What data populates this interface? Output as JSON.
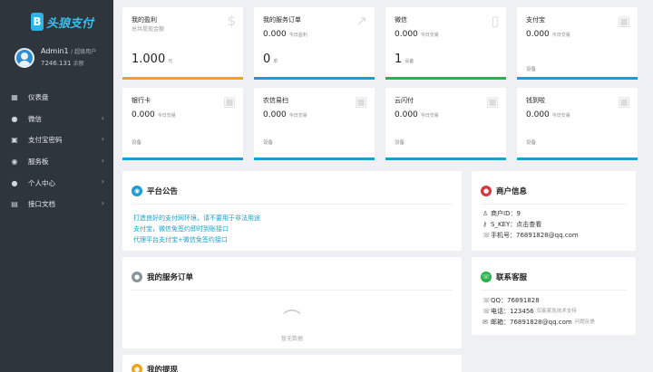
{
  "sidebar": {
    "logo_mark": "B",
    "logo_text": "头狼支付",
    "user_name": "Admin1",
    "user_role": "/ 超级用户",
    "balance": "7246.131",
    "balance_unit": "余额",
    "items": [
      {
        "label": "仪表盘",
        "icon": "dashboard-icon",
        "glyph": "▦",
        "chevron": false
      },
      {
        "label": "微信",
        "icon": "wechat-icon",
        "glyph": "●",
        "chevron": true
      },
      {
        "label": "支付宝密码",
        "icon": "card-icon",
        "glyph": "▣",
        "chevron": true
      },
      {
        "label": "服务板",
        "icon": "service-icon",
        "glyph": "◉",
        "chevron": true
      },
      {
        "label": "个人中心",
        "icon": "user-icon",
        "glyph": "●",
        "chevron": true
      },
      {
        "label": "接口文档",
        "icon": "docs-icon",
        "glyph": "▤",
        "chevron": true
      }
    ]
  },
  "stats": [
    {
      "title": "我的盈利",
      "sub": "总共提现金额",
      "value": "1.000",
      "unit": "元",
      "color": "#f4a11a",
      "watermark": "$"
    },
    {
      "title": "我的服务订单",
      "value": "0.000",
      "unit": "今日盈利",
      "value2": "0",
      "unit2": "单",
      "color": "#1e9bd7",
      "watermark": "↗"
    },
    {
      "title": "微信",
      "value": "0.000",
      "unit": "今日交易",
      "value2": "1",
      "unit2": "设备",
      "color": "#27b24a",
      "watermark": "▯"
    },
    {
      "title": "支付宝",
      "value": "0.000",
      "unit": "今日交易",
      "label": "设备",
      "color": "#1e9bd7",
      "watermark": "▣"
    },
    {
      "title": "银行卡",
      "value": "0.000",
      "unit": "今日交易",
      "label": "设备",
      "color": "#1e9bd7",
      "watermark": "▣"
    },
    {
      "title": "农信易扫",
      "value": "0.000",
      "unit": "今日交易",
      "label": "设备",
      "color": "#1e9bd7",
      "watermark": "▣"
    },
    {
      "title": "云闪付",
      "value": "0.000",
      "unit": "今日交易",
      "label": "设备",
      "color": "#1e9bd7",
      "watermark": "▣"
    },
    {
      "title": "钱到啦",
      "value": "0.000",
      "unit": "今日交易",
      "label": "设备",
      "color": "#1e9bd7",
      "watermark": "▣"
    }
  ],
  "announcement": {
    "title": "平台公告",
    "lines": [
      "打造良好的支付网环境，请不要用于非法用途",
      "支付宝，微信免签约即时到账接口",
      "代理平台支付宝+微信免签约接口"
    ]
  },
  "merchant": {
    "title": "商户信息",
    "id_label": "商户ID：9",
    "key_label": "S_KEY：点击查看",
    "phone_label": "手机号：76891828@qq.com"
  },
  "orders": {
    "title": "我的服务订单",
    "empty_text": "暂无数据"
  },
  "support": {
    "title": "联系客服",
    "qq": "QQ：76891828",
    "tel": "电话：123456",
    "tel_note": "仅能紧急技术支持",
    "email": "邮箱：76891828@qq.com",
    "email_note": "问题反馈"
  },
  "withdraw": {
    "title": "我的提现"
  },
  "colors": {
    "sidebar_bg": "#2f353d",
    "accent_blue": "#1e9bd7",
    "accent_orange": "#f4a11a",
    "accent_green": "#27b24a",
    "accent_red": "#d9363e",
    "accent_gray": "#8a939c"
  }
}
